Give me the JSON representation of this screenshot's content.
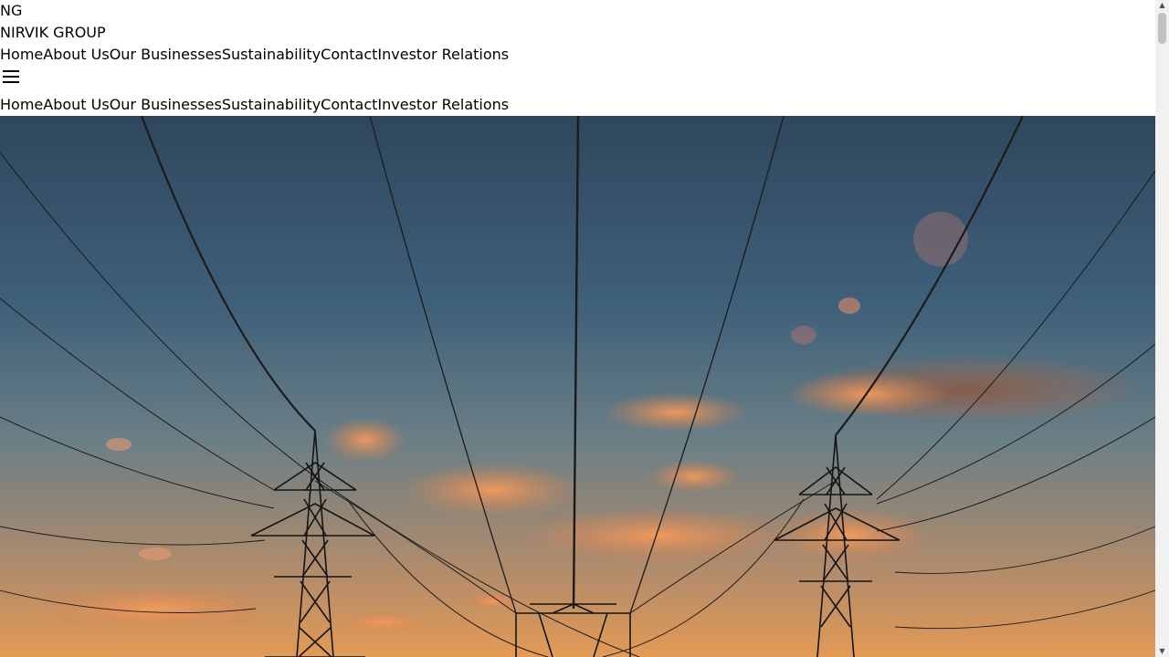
{
  "header": {
    "logo_initials": "NG",
    "brand_name": "NIRVIK GROUP"
  },
  "nav_primary": [
    {
      "label": "Home"
    },
    {
      "label": "About Us"
    },
    {
      "label": "Our Businesses"
    },
    {
      "label": "Sustainability"
    },
    {
      "label": "Contact"
    },
    {
      "label": "Investor Relations"
    }
  ],
  "nav_mobile": [
    {
      "label": "Home"
    },
    {
      "label": "About Us"
    },
    {
      "label": "Our Businesses"
    },
    {
      "label": "Sustainability"
    },
    {
      "label": "Contact"
    },
    {
      "label": "Investor Relations"
    }
  ],
  "icons": {
    "menu": "hamburger-menu-icon",
    "scroll_up": "triangle-up",
    "scroll_down": "triangle-down"
  },
  "hero": {
    "image_subject": "power transmission towers at sunset"
  },
  "colors": {
    "text": "#000000",
    "background": "#ffffff",
    "sky_top": "#2f475e",
    "sky_bottom": "#e39a55"
  }
}
